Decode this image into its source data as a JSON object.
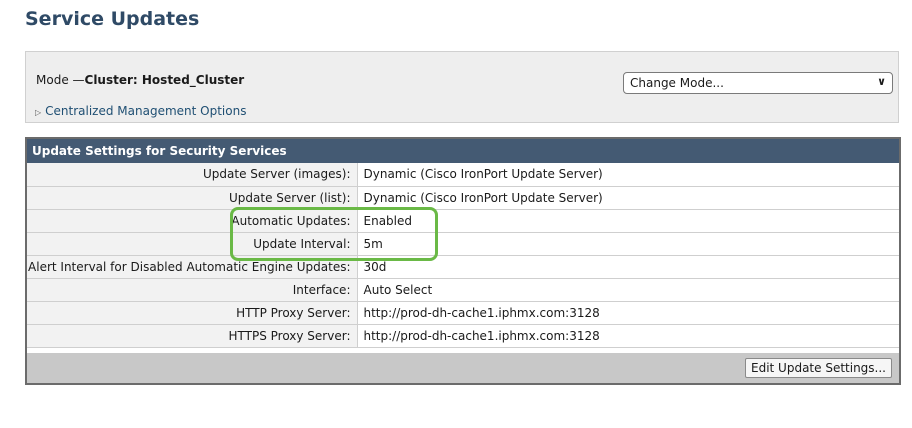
{
  "page": {
    "title": "Service Updates"
  },
  "mode": {
    "prefix": "Mode —",
    "cluster": "Cluster: Hosted_Cluster",
    "change_mode_label": "Change Mode...",
    "centralized_link": "Centralized Management Options"
  },
  "settings": {
    "header": "Update Settings for Security Services",
    "rows": [
      {
        "label": "Update Server (images):",
        "value": "Dynamic (Cisco IronPort Update Server)"
      },
      {
        "label": "Update Server (list):",
        "value": "Dynamic (Cisco IronPort Update Server)"
      },
      {
        "label": "Automatic Updates:",
        "value": "Enabled"
      },
      {
        "label": "Update Interval:",
        "value": "5m"
      },
      {
        "label": "Alert Interval for Disabled Automatic Engine Updates:",
        "value": "30d"
      },
      {
        "label": "Interface:",
        "value": "Auto Select"
      },
      {
        "label": "HTTP Proxy Server:",
        "value": "http://prod-dh-cache1.iphmx.com:3128"
      },
      {
        "label": "HTTPS Proxy Server:",
        "value": "http://prod-dh-cache1.iphmx.com:3128"
      }
    ],
    "edit_button": "Edit Update Settings..."
  },
  "colors": {
    "header_bg": "#445a73",
    "title": "#2f4a66",
    "highlight": "#6ab946"
  }
}
